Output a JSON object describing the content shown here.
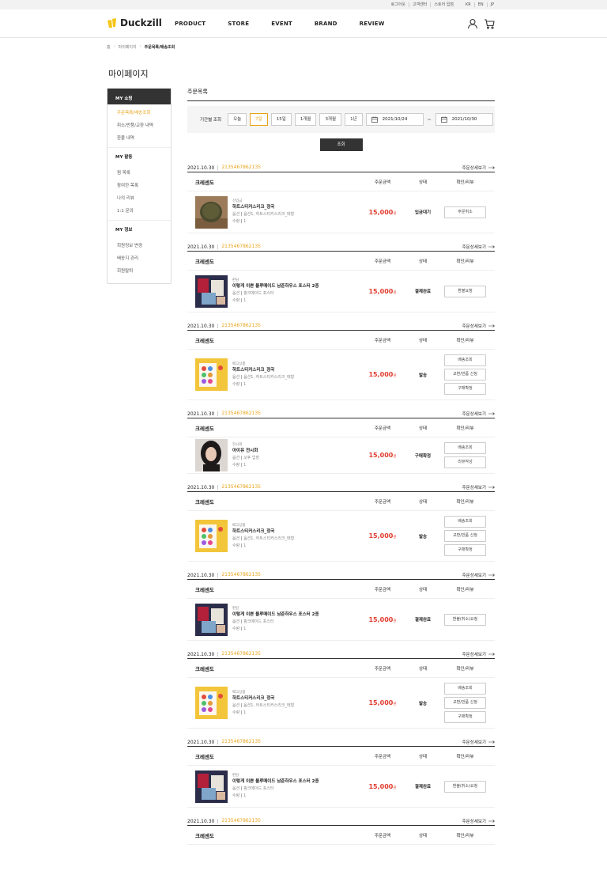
{
  "util": {
    "links": [
      "로그아웃",
      "고객센터",
      "스토어 입점"
    ],
    "langs": [
      "KR",
      "EN",
      "JP"
    ]
  },
  "brand": {
    "name": "Duckzill",
    "color": "#f5c518"
  },
  "nav": [
    "PRODUCT",
    "STORE",
    "EVENT",
    "BRAND",
    "REVIEW"
  ],
  "breadcrumb": [
    "홈",
    "마이페이지",
    "주문목록/배송조회"
  ],
  "page_title": "마이페이지",
  "sidebar": {
    "head": "MY 쇼핑",
    "shopping": [
      "주문목록/배송조회",
      "취소/반품/교환 내역",
      "환불 내역"
    ],
    "activity_title": "MY 활동",
    "activity": [
      "찜 목록",
      "참여한 목록",
      "나의 리뷰",
      "1:1 문의"
    ],
    "info_title": "MY 정보",
    "info": [
      "회원정보 변경",
      "배송지 관리",
      "회원탈퇴"
    ]
  },
  "section_title": "주문목록",
  "filter": {
    "label": "기간별 조회",
    "periods": [
      "오늘",
      "7일",
      "15일",
      "1개월",
      "3개월",
      "1년"
    ],
    "active_period": "7일",
    "date_from": "2021/10/24",
    "date_to": "2021/10/30",
    "tilde": "~",
    "search_label": "조회"
  },
  "columns": {
    "amount": "주문금액",
    "state": "상태",
    "action": "확인/리뷰"
  },
  "detail_label": "주문상세보기",
  "accent": "#e8a317",
  "price_color": "#e03c2e",
  "orders": [
    {
      "date": "2021.10.30",
      "no": "2135467862135",
      "shop": "크레센도",
      "category": "선입금",
      "name": "하트스티커스리크_정국",
      "opt_label": "옵션",
      "option": "옵션1, 하트스티커스리크_태형",
      "qty_label": "수량",
      "qty": "1",
      "price": "15,000",
      "unit": "원",
      "state": "입금대기",
      "actions": [
        "주문취소"
      ],
      "thumb": "pouch"
    },
    {
      "date": "2021.10.30",
      "no": "2135467862135",
      "shop": "크레센도",
      "category": "판담",
      "name": "이렇게 이쁜 블루메이드 남준하우스 포스터 2종",
      "opt_label": "옵션",
      "option": "핑크메이드 포스터",
      "qty_label": "수량",
      "qty": "1",
      "price": "15,000",
      "unit": "원",
      "state": "결제완료",
      "actions": [
        "환불요청"
      ],
      "thumb": "poster"
    },
    {
      "date": "2021.10.30",
      "no": "2135467862135",
      "shop": "크레센도",
      "category": "배고상품",
      "name": "하트스티커스리크_정국",
      "opt_label": "옵션",
      "option": "옵션1, 하트스티커스리크_태형",
      "qty_label": "수량",
      "qty": "1",
      "price": "15,000",
      "unit": "원",
      "state": "발송",
      "actions": [
        "배송조회",
        "교환/반품 신청",
        "구매확정"
      ],
      "thumb": "sticker"
    },
    {
      "date": "2021.10.30",
      "no": "2135467862135",
      "shop": "크레센도",
      "category": "전시회",
      "name": "아이유 전시회",
      "opt_label": "옵션",
      "option": "오후 입장",
      "qty_label": "수량",
      "qty": "1",
      "price": "15,000",
      "unit": "원",
      "state": "구매확정",
      "actions": [
        "배송조회",
        "리뷰작성"
      ],
      "thumb": "portrait"
    },
    {
      "date": "2021.10.30",
      "no": "2135467862135",
      "shop": "크레센도",
      "category": "배고상품",
      "name": "하트스티커스리크_정국",
      "opt_label": "옵션",
      "option": "옵션1, 하트스티커스리크_태형",
      "qty_label": "수량",
      "qty": "1",
      "price": "15,000",
      "unit": "원",
      "state": "발송",
      "actions": [
        "배송조회",
        "교환/반품 신청",
        "구매확정"
      ],
      "thumb": "sticker"
    },
    {
      "date": "2021.10.30",
      "no": "2135467862135",
      "shop": "크레센도",
      "category": "판담",
      "name": "이렇게 이쁜 블루메이드 남준하우스 포스터 2종",
      "opt_label": "옵션",
      "option": "핑크메이드 포스터",
      "qty_label": "수량",
      "qty": "1",
      "price": "15,000",
      "unit": "원",
      "state": "결제완료",
      "actions": [
        "환불(취소)요청"
      ],
      "thumb": "poster"
    },
    {
      "date": "2021.10.30",
      "no": "2135467862135",
      "shop": "크레센도",
      "category": "배고상품",
      "name": "하트스티커스리크_정국",
      "opt_label": "옵션",
      "option": "옵션1, 하트스티커스리크_태형",
      "qty_label": "수량",
      "qty": "1",
      "price": "15,000",
      "unit": "원",
      "state": "발송",
      "actions": [
        "배송조회",
        "교환/반품 신청",
        "구매확정"
      ],
      "thumb": "sticker"
    },
    {
      "date": "2021.10.30",
      "no": "2135467862135",
      "shop": "크레센도",
      "category": "판담",
      "name": "이렇게 이쁜 블루메이드 남준하우스 포스터 2종",
      "opt_label": "옵션",
      "option": "핑크메이드 포스터",
      "qty_label": "수량",
      "qty": "1",
      "price": "15,000",
      "unit": "원",
      "state": "결제완료",
      "actions": [
        "환불(취소)요청"
      ],
      "thumb": "poster"
    },
    {
      "date": "2021.10.30",
      "no": "2135467862135",
      "shop": "크레센도",
      "category": "",
      "name": "",
      "opt_label": "",
      "option": "",
      "qty_label": "",
      "qty": "",
      "price": "",
      "unit": "",
      "state": "",
      "actions": [],
      "thumb": ""
    }
  ]
}
